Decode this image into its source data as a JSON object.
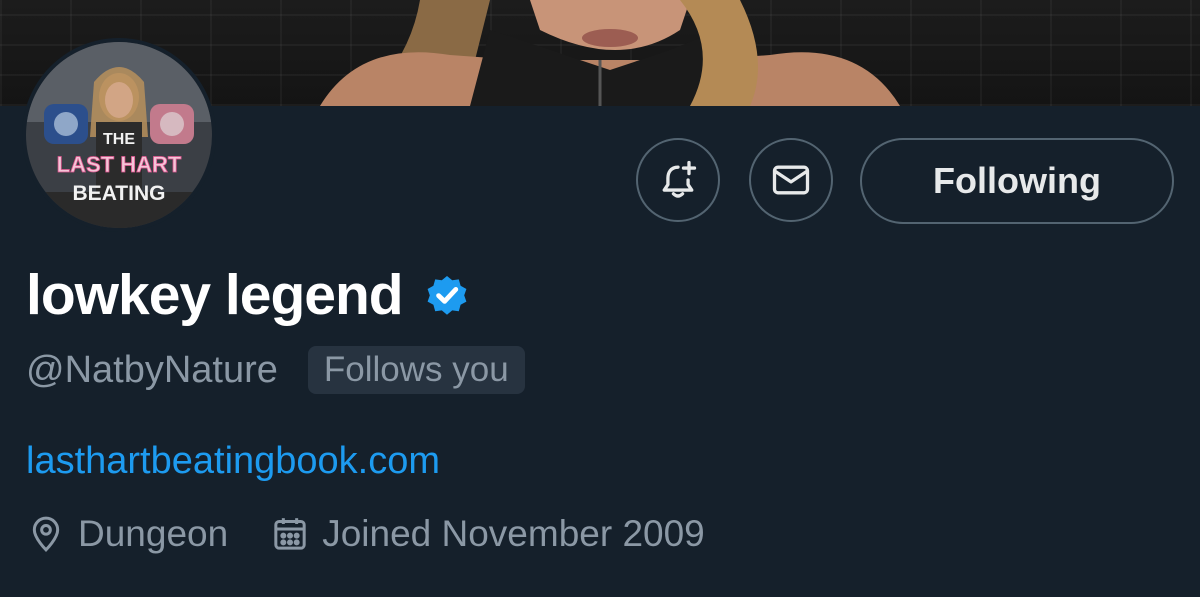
{
  "profile": {
    "display_name": "lowkey legend",
    "handle": "@NatbyNature",
    "follows_you": "Follows you",
    "website": "lasthartbeatingbook.com",
    "location": "Dungeon",
    "joined": "Joined November 2009"
  },
  "avatar": {
    "text_line1": "THE",
    "text_line2": "LAST HART",
    "text_line3": "BEATING"
  },
  "actions": {
    "following_label": "Following",
    "notify_icon": "bell-plus-icon",
    "message_icon": "envelope-icon"
  },
  "colors": {
    "background": "#15202b",
    "accent": "#1d9bf0",
    "muted_text": "#8b98a5",
    "border": "#536471"
  }
}
